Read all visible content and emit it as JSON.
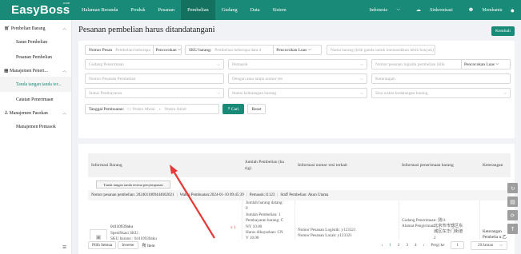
{
  "app": {
    "logo": "EasyBoss",
    "logo_suffix": ".com"
  },
  "nav": [
    "Halaman Beranda",
    "Produk",
    "Pesanan",
    "Pembelian",
    "Gudang",
    "Data",
    "Sistem"
  ],
  "top_right": {
    "language": "Indonesia",
    "sync": "Sinkronisasi",
    "help": "Membantu"
  },
  "sidebar": {
    "groups": [
      {
        "label": "Pembelian Barang",
        "items": [
          "Saran Pembelian",
          "Pesanan Pembelian"
        ]
      },
      {
        "label": "Manajemen Peneri...",
        "items": [
          "Tanda tangan tanda ter...",
          "Catatan Penerimaan"
        ]
      },
      {
        "label": "Manajemen Pasokan",
        "items": [
          "Manajemen Pemasok"
        ]
      }
    ],
    "active_item": "Tanda tangan tanda ter..."
  },
  "page": {
    "title": "Pesanan pembelian harus ditandatangani",
    "back_label": "Kembali"
  },
  "filters": {
    "nomor_pesan_label": "Nomor Pesan",
    "nomor_pesan_placeholder": "Pembelian beberapa",
    "nomor_pesan_match": "Pencocokan",
    "sku_label": "SKU barang:",
    "sku_placeholder": "Pembelian beberapa data d",
    "sku_match": "Pencocokan Luas",
    "nama_placeholder": "Nama barang (klik ganda untuk memasukkan lebih banyak)",
    "gudang_placeholder": "Gudang Penerimaan",
    "pemasok_placeholder": "Pemasok",
    "logistik_placeholder": "Nomor pesanan logistik pembelian (klik",
    "logistik_match": "Pencocokan Luas",
    "nomor_pembelian_placeholder": "Nomor Pesanan Pembelian",
    "dengan_placeholder": "Dengan atau tanpa nomor res",
    "keterangan_placeholder": "Keterangan",
    "status_pembayaran_placeholder": "Status Pembayaran",
    "status_kedatangan_placeholder": "Status kedatangan barang",
    "sisa_waktu_placeholder": "Sisa waktu kedatangan barang",
    "tanggal_label": "Tanggal Pembuatan:",
    "tanggal_start": "Waktu Mulai",
    "tanggal_end": "Waktu Akhir",
    "search_label": "Cari",
    "reset_label": "Reset"
  },
  "table": {
    "headers": [
      "Informasi Barang",
      "Jumlah Pembelian (ba rig)",
      "Informasi nomor resi terkait",
      "Informasi penerimaan barang",
      "Keterangan"
    ],
    "sign_button": "Tanda tangan tanda terima penyimpanan",
    "order_info": {
      "nomor": "Nomor pesanan pembelian: 2024011009444602021",
      "waktu": "Waktu Pembuatan:2024-01-10 09:45:39",
      "pemasok": "Pemasok:11123",
      "staff": "Staff Pembelian: Akun Utama"
    },
    "row": {
      "product_code": "04110939aku",
      "spesifikasi": "Spesifikasi SKU:",
      "sku": "SKU barang :   04110939aku",
      "qty": "x 1",
      "qty_details": [
        "Jumlah barang datang:",
        "0",
        "Jumlah Pembelian: 1",
        "Pembayaran barang: C",
        "NY 10.00",
        "Harus dibayarkan: CN",
        "Y 10.00"
      ],
      "resi_logistik": "Nomor Pesanan Logistik:   y123321",
      "resi_pelacakan": "Nomor Pesanan Lacak:   y123321",
      "gudang": "Gudang Penerimaan:   测11",
      "alamat_label": "Alamat Pengiriman:",
      "alamat": [
        "北京市市辖区东",
        "城区东华门街道",
        "2"
      ],
      "keterangan": "Keterangan Pembelia n:乙"
    }
  },
  "pagination": {
    "select_all": "Pilih Semua",
    "invert": "Inverse",
    "count": "所 Item",
    "pages": [
      "1",
      "2",
      "3",
      "4"
    ],
    "current": "1",
    "goto_label": "Pergi ke",
    "goto_value": "1",
    "page_size": "20/laman"
  },
  "colors": {
    "brand": "#1a8a78",
    "brand_dark": "#14705f",
    "arrow": "#e53935"
  }
}
